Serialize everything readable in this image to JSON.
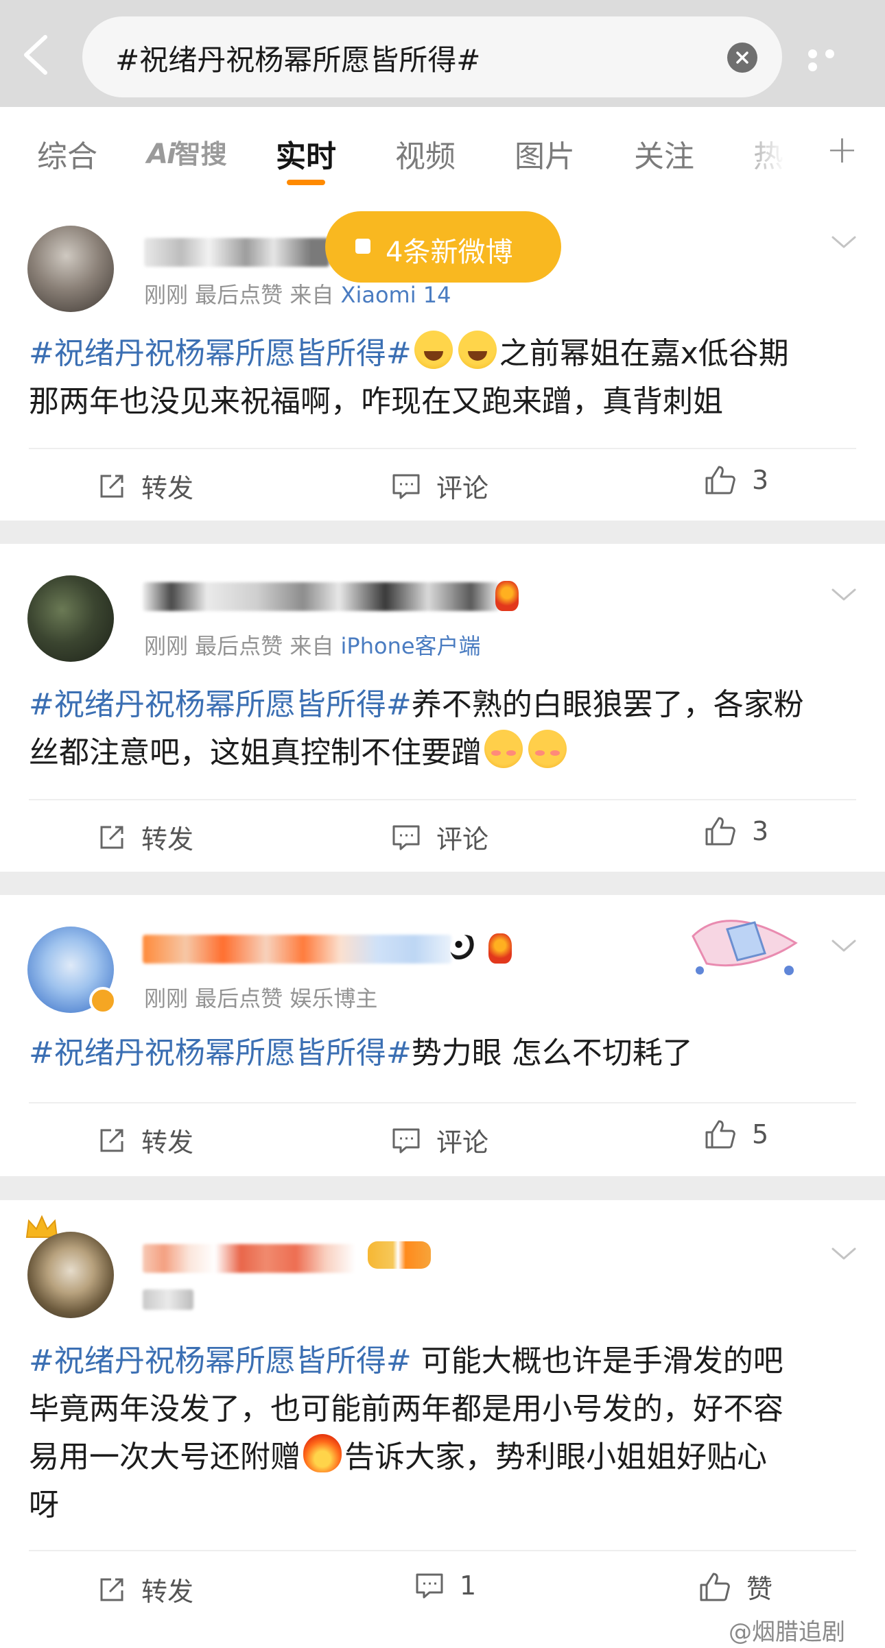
{
  "search": {
    "query": "#祝绪丹祝杨幂所愿皆所得#"
  },
  "tabs": [
    "综合",
    "智搜",
    "实时",
    "视频",
    "图片",
    "关注",
    "热"
  ],
  "ai_label": "Ai",
  "active_tab": "实时",
  "toast": {
    "text": "4条新微博"
  },
  "posts": [
    {
      "meta_prefix": "刚刚  最后点赞  来自",
      "source": "Xiaomi 14",
      "hashtag": "#祝绪丹祝杨幂所愿皆所得#",
      "text_a": "之前幂姐在嘉x低谷期",
      "text_b": "那两年也没见来祝福啊，咋现在又跑来蹭，真背刺姐",
      "repost": "转发",
      "comment": "评论",
      "likes": "3"
    },
    {
      "meta_prefix": "刚刚  最后点赞  来自",
      "source": "iPhone客户端",
      "hashtag": "#祝绪丹祝杨幂所愿皆所得#",
      "text_a": "养不熟的白眼狼罢了，各家粉",
      "text_b": "丝都注意吧，这姐真控制不住要蹭",
      "repost": "转发",
      "comment": "评论",
      "likes": "3"
    },
    {
      "meta_prefix": "刚刚  最后点赞  娱乐博主",
      "hashtag": "#祝绪丹祝杨幂所愿皆所得#",
      "text_a": "势力眼 怎么不切耗了",
      "repost": "转发",
      "comment": "评论",
      "likes": "5"
    },
    {
      "hashtag": "#祝绪丹祝杨幂所愿皆所得#",
      "text_a": " 可能大概也许是手滑发的吧",
      "text_b": "毕竟两年没发了，也可能前两年都是用小号发的，好不容",
      "text_c": "易用一次大号还附赠",
      "text_d": "告诉大家，势利眼小姐姐好贴心",
      "text_e": "呀",
      "repost": "转发",
      "comment": "1",
      "likes": "赞"
    }
  ],
  "watermark": "@烟腊追剧",
  "colors": {
    "accent": "#ff8a00",
    "toast": "#f9b820",
    "link": "#3b6fb3"
  }
}
